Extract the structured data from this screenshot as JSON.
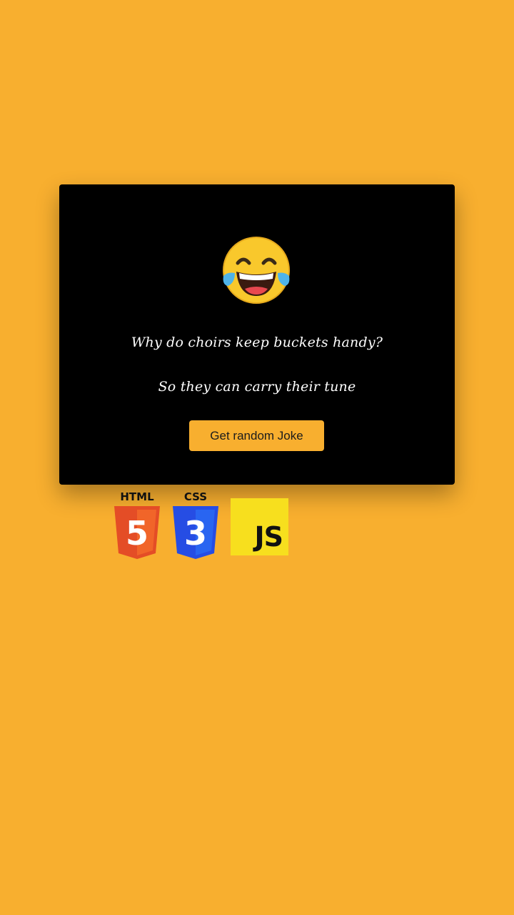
{
  "card": {
    "emoji_icon": "face-with-tears-of-joy-icon",
    "setup": "Why do choirs keep buckets handy?",
    "punchline": "So they can carry their tune",
    "button_label": "Get random Joke"
  },
  "logos": {
    "html_label": "HTML",
    "html_digit": "5",
    "css_label": "CSS",
    "css_digit": "3",
    "js_label": "JS"
  },
  "colors": {
    "background": "#f8af2f",
    "card": "#000000",
    "button": "#f8af2f",
    "html_orange": "#e44d26",
    "css_blue": "#264de4",
    "js_yellow": "#f7df1e"
  }
}
